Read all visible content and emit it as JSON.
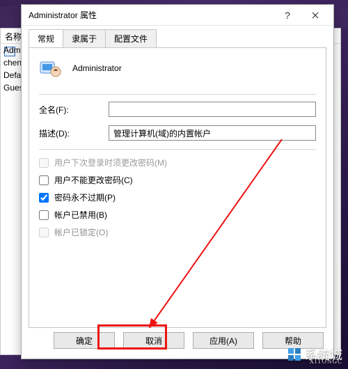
{
  "dialog": {
    "title": "Administrator 属性",
    "tabs": [
      {
        "label": "常规",
        "active": true
      },
      {
        "label": "隶属于",
        "active": false
      },
      {
        "label": "配置文件",
        "active": false
      }
    ],
    "user_display": "Administrator",
    "fields": {
      "fullname_label": "全名(F):",
      "fullname_value": "",
      "description_label": "描述(D):",
      "description_value": "管理计算机(域)的内置帐户"
    },
    "checkboxes": [
      {
        "label": "用户下次登录时须更改密码(M)",
        "checked": false,
        "disabled": true
      },
      {
        "label": "用户不能更改密码(C)",
        "checked": false,
        "disabled": false
      },
      {
        "label": "密码永不过期(P)",
        "checked": true,
        "disabled": false
      },
      {
        "label": "帐户已禁用(B)",
        "checked": false,
        "disabled": false
      },
      {
        "label": "帐户已锁定(O)",
        "checked": false,
        "disabled": true
      }
    ],
    "buttons": {
      "ok": "确定",
      "cancel": "取消",
      "apply": "应用(A)",
      "help": "帮助"
    }
  },
  "back_panel": {
    "column": "名称",
    "items": [
      "Admini",
      "cheng",
      "Defau",
      "Gues"
    ]
  },
  "watermark": {
    "main": "系统城",
    "sub": "XITONGC"
  },
  "colors": {
    "highlight": "#e11111",
    "arrow": "#e11111"
  }
}
